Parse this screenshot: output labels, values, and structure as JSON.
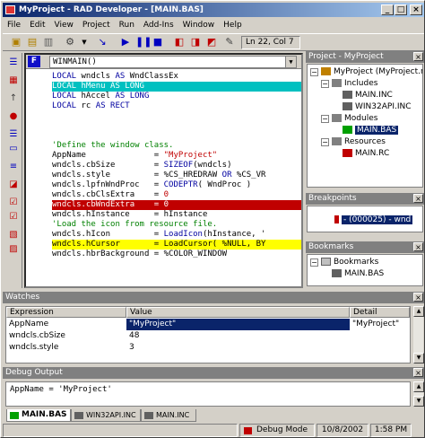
{
  "window": {
    "title": "MyProject - RAD Developer - [MAIN.BAS]"
  },
  "menu": [
    "File",
    "Edit",
    "View",
    "Project",
    "Run",
    "Add-Ins",
    "Window",
    "Help"
  ],
  "toolbar": {
    "position": "Ln 22, Col 7"
  },
  "editor": {
    "file_icon": "F",
    "procedure": "WINMAIN()",
    "lines": [
      {
        "text": "LOCAL wndcls AS WndClassEx",
        "hl": ""
      },
      {
        "text": "LOCAL hMenu AS LONG",
        "hl": "cyan"
      },
      {
        "text": "LOCAL hAccel AS LONG",
        "hl": ""
      },
      {
        "text": "LOCAL rc AS RECT",
        "hl": ""
      },
      {
        "text": "",
        "hl": ""
      },
      {
        "text": "",
        "hl": ""
      },
      {
        "text": "",
        "hl": ""
      },
      {
        "text": "'Define the window class.",
        "hl": ""
      },
      {
        "text": "AppName              = \"MyProject\"",
        "hl": ""
      },
      {
        "text": "wndcls.cbSize        = SIZEOF(wndcls)",
        "hl": ""
      },
      {
        "text": "wndcls.style         = %CS_HREDRAW OR %CS_VR",
        "hl": ""
      },
      {
        "text": "wndcls.lpfnWndProc   = CODEPTR( WndProc )",
        "hl": ""
      },
      {
        "text": "wndcls.cbClsExtra    = 0",
        "hl": ""
      },
      {
        "text": "wndcls.cbWndExtra    = 0",
        "hl": "red"
      },
      {
        "text": "wndcls.hInstance     = hInstance",
        "hl": ""
      },
      {
        "text": "'Load the icon from resource file.",
        "hl": ""
      },
      {
        "text": "wndcls.hIcon         = LoadIcon(hInstance, '",
        "hl": ""
      },
      {
        "text": "wndcls.hCursor       = LoadCursor( %NULL, BY",
        "hl": "yellow"
      },
      {
        "text": "wndcls.hbrBackground = %COLOR_WINDOW",
        "hl": ""
      }
    ]
  },
  "project": {
    "title": "Project - MyProject",
    "tree": [
      {
        "label": "MyProject (MyProject.rac",
        "level": 0,
        "selected": false
      },
      {
        "label": "Includes",
        "level": 1,
        "selected": false
      },
      {
        "label": "MAIN.INC",
        "level": 2,
        "selected": false
      },
      {
        "label": "WIN32API.INC",
        "level": 2,
        "selected": false
      },
      {
        "label": "Modules",
        "level": 1,
        "selected": false
      },
      {
        "label": "MAIN.BAS",
        "level": 2,
        "selected": true
      },
      {
        "label": "Resources",
        "level": 1,
        "selected": false
      },
      {
        "label": "MAIN.RC",
        "level": 2,
        "selected": false
      }
    ]
  },
  "breakpoints": {
    "title": "Breakpoints",
    "items": [
      "- (000025) - wnd"
    ]
  },
  "bookmarks": {
    "title": "Bookmarks",
    "root": "Bookmarks",
    "items": [
      "MAIN.BAS"
    ]
  },
  "watches": {
    "title": "Watches",
    "columns": [
      "Expression",
      "Value",
      "Detail"
    ],
    "rows": [
      {
        "expr": "AppName",
        "value": "\"MyProject\"",
        "detail": "\"MyProject\"",
        "selected": true
      },
      {
        "expr": "wndcls.cbSize",
        "value": "48",
        "detail": "",
        "selected": false
      },
      {
        "expr": "wndcls.style",
        "value": "3",
        "detail": "",
        "selected": false
      }
    ]
  },
  "debug": {
    "title": "Debug Output",
    "text": "AppName = 'MyProject'"
  },
  "tabs": [
    "MAIN.BAS",
    "WIN32API.INC",
    "MAIN.INC"
  ],
  "status": {
    "mode": "Debug Mode",
    "date": "10/8/2002",
    "time": "1:58 PM"
  },
  "colors": {
    "title_start": "#0a246a",
    "title_end": "#a6caf0",
    "selection": "#0a246a",
    "exec_line": "#ffff00",
    "breakpoint_line": "#c00000",
    "current_line": "#00c0c0"
  }
}
